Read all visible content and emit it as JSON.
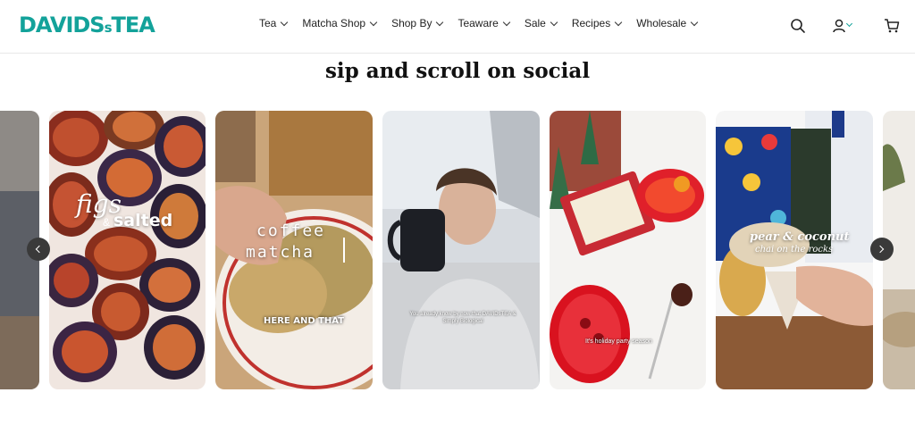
{
  "brand": {
    "logo_main": "DAVIDS",
    "logo_s": "s",
    "logo_tea": "TEA",
    "color": "#13a29a"
  },
  "nav": {
    "items": [
      {
        "label": "Tea"
      },
      {
        "label": "Matcha Shop"
      },
      {
        "label": "Shop By"
      },
      {
        "label": "Teaware"
      },
      {
        "label": "Sale"
      },
      {
        "label": "Recipes"
      },
      {
        "label": "Wholesale"
      }
    ]
  },
  "header_icons": [
    "search-icon",
    "account-icon",
    "chevron-down-icon",
    "cart-icon"
  ],
  "section": {
    "title": "sip and scroll on social"
  },
  "posts": [
    {
      "overlay": ""
    },
    {
      "overlay_script": "figs",
      "overlay_amp": "&",
      "overlay_word": "salted"
    },
    {
      "overlay_line1": "coffee",
      "overlay_line2": "matcha",
      "overlay_caption": "HERE AND THAT"
    },
    {
      "overlay_caption": "You already know by now that DAVIDsTEA & Simply Biological"
    },
    {
      "overlay_caption": "It's holiday party season"
    },
    {
      "overlay_line1": "pear & coconut",
      "overlay_line2": "chai on the rocks"
    },
    {
      "overlay": ""
    }
  ],
  "carousel_controls": {
    "prev": "chevron-left-icon",
    "next": "chevron-right-icon"
  }
}
